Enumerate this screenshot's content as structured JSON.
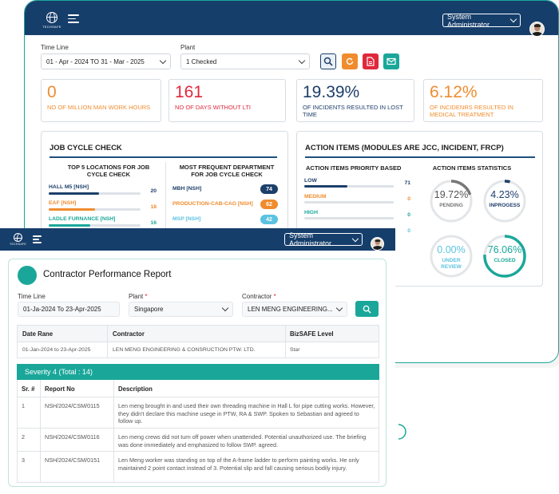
{
  "dashboard": {
    "logo_text": "TECHSAFE",
    "user_select": "System Administrator",
    "filters": {
      "timeline_label": "Time Line",
      "timeline_value": "01 - Apr - 2024  TO 31 - Mar - 2025",
      "plant_label": "Plant",
      "plant_value": "1 Checked"
    },
    "toolbar_icons": [
      "search-icon",
      "refresh-icon",
      "pdf-icon",
      "email-icon"
    ],
    "kpis": [
      {
        "value": "0",
        "label": "NO OF MILLION MAN WORK HOURS",
        "color": "#f08c2e"
      },
      {
        "value": "161",
        "label": "NO OF DAYS WITHOUT LTI",
        "color": "#e0283c"
      },
      {
        "value": "19.39%",
        "label": "OF INCIDENTS RESULTED IN LOST TIME",
        "color": "#1d3f6a"
      },
      {
        "value": "6.12%",
        "label": "OF INCIDENRS RESULTED IN MEDICAL TREATMENT",
        "color": "#f08c2e"
      }
    ],
    "job_cycle": {
      "title": "JOB CYCLE CHECK",
      "locations_title": "TOP 5 LOCATIONS FOR JOB CYCLE CHECK",
      "locations": [
        {
          "name": "HALL M5 [NSH]",
          "value": "20",
          "fill": 0.55,
          "color": "#1d3f6a"
        },
        {
          "name": "EAF [NSH]",
          "value": "18",
          "fill": 0.5,
          "color": "#f08c2e"
        },
        {
          "name": "LADLE FURNANCE [NSH]",
          "value": "16",
          "fill": 0.45,
          "color": "#1aa79a"
        }
      ],
      "departments_title": "MOST FREQUENT DEPARTMENT FOR JOB CYCLE CHECK",
      "departments": [
        {
          "name": "MBH [NSH]",
          "value": "74",
          "color": "#1d3f6a"
        },
        {
          "name": "PRODUCTION-CAB-CAG [NSH]",
          "value": "62",
          "color": "#f08c2e"
        },
        {
          "name": "MSP [NSH]",
          "value": "42",
          "color": "#5bc3e0"
        }
      ]
    },
    "action_items": {
      "title": "ACTION ITEMS (MODULES ARE JCC, INCIDENT, FRCP)",
      "priority_title": "ACTION ITEMS PRIORITY BASED",
      "priorities": [
        {
          "name": "LOW",
          "value": "71",
          "fill": 0.48,
          "color": "#1d3f6a"
        },
        {
          "name": "MEDIUM",
          "value": "0",
          "fill": 0,
          "color": "#f08c2e"
        },
        {
          "name": "HIGH",
          "value": "0",
          "fill": 0,
          "color": "#1aa79a"
        },
        {
          "name": "",
          "value": "0",
          "fill": 0,
          "color": "#5bc3e0"
        }
      ],
      "stats_title": "ACTION ITEMS STATISTICS",
      "stats": [
        {
          "value": "19.72%",
          "label": "PENDING",
          "fraction": 0.1972,
          "color": "#777777"
        },
        {
          "value": "4.23%",
          "label": "INPROGESS",
          "fraction": 0.0423,
          "color": "#1d3f6a"
        },
        {
          "value": "0.00%",
          "label": "UNDER REVIEW",
          "fraction": 0,
          "color": "#5bc3e0"
        },
        {
          "value": "76.06%",
          "label": "CLOSED",
          "fraction": 0.7606,
          "color": "#1aa79a"
        }
      ]
    }
  },
  "report": {
    "user_select": "System Administrator",
    "title": "Contractor Performance Report",
    "filters": {
      "timeline_label": "Time Line",
      "timeline_value": "01-Ja-2024 To 23-Apr-2025",
      "plant_label": "Plant",
      "plant_value": "Singapore",
      "contractor_label": "Contractor",
      "contractor_value": "LEN MENG ENGINEERING...",
      "required_mark": "*"
    },
    "summary_headers": [
      "Date Rane",
      "Contractor",
      "BizSAFE Level"
    ],
    "summary_row": [
      "01-Jan-2024 to 23-Apr-2025",
      "LEN MENG ENGINEERING & CONSRUCTION PTW. LTD.",
      "Star"
    ],
    "severity_title": "Severity 4 (Total : 14)",
    "detail_headers": [
      "Sr. #",
      "Report No",
      "Description"
    ],
    "rows": [
      {
        "sr": "1",
        "report": "NSH/2024/CSM/0115",
        "desc": "Len meng brought in and used their own threading machine in Hall L for pipe cutting works. However, they didn't declare this machine usege in PTW, RA & SWP. Spoken to Sebastian and agreed to follow up."
      },
      {
        "sr": "2",
        "report": "NSH/2024/CSM/0116",
        "desc": "Len meng crews did not turn off power when unattended. Potential unauthorized use. The briefing was done immediately and emphasized to follow SWP. agreed."
      },
      {
        "sr": "3",
        "report": "NSH/2024/CSM/0151",
        "desc": "Len Meng worker was standing on top of the A-frame ladder to perform painting works. He only maintained 2 point contact instead of 3. Potential slip and fall causing serious bodily injury."
      }
    ]
  }
}
